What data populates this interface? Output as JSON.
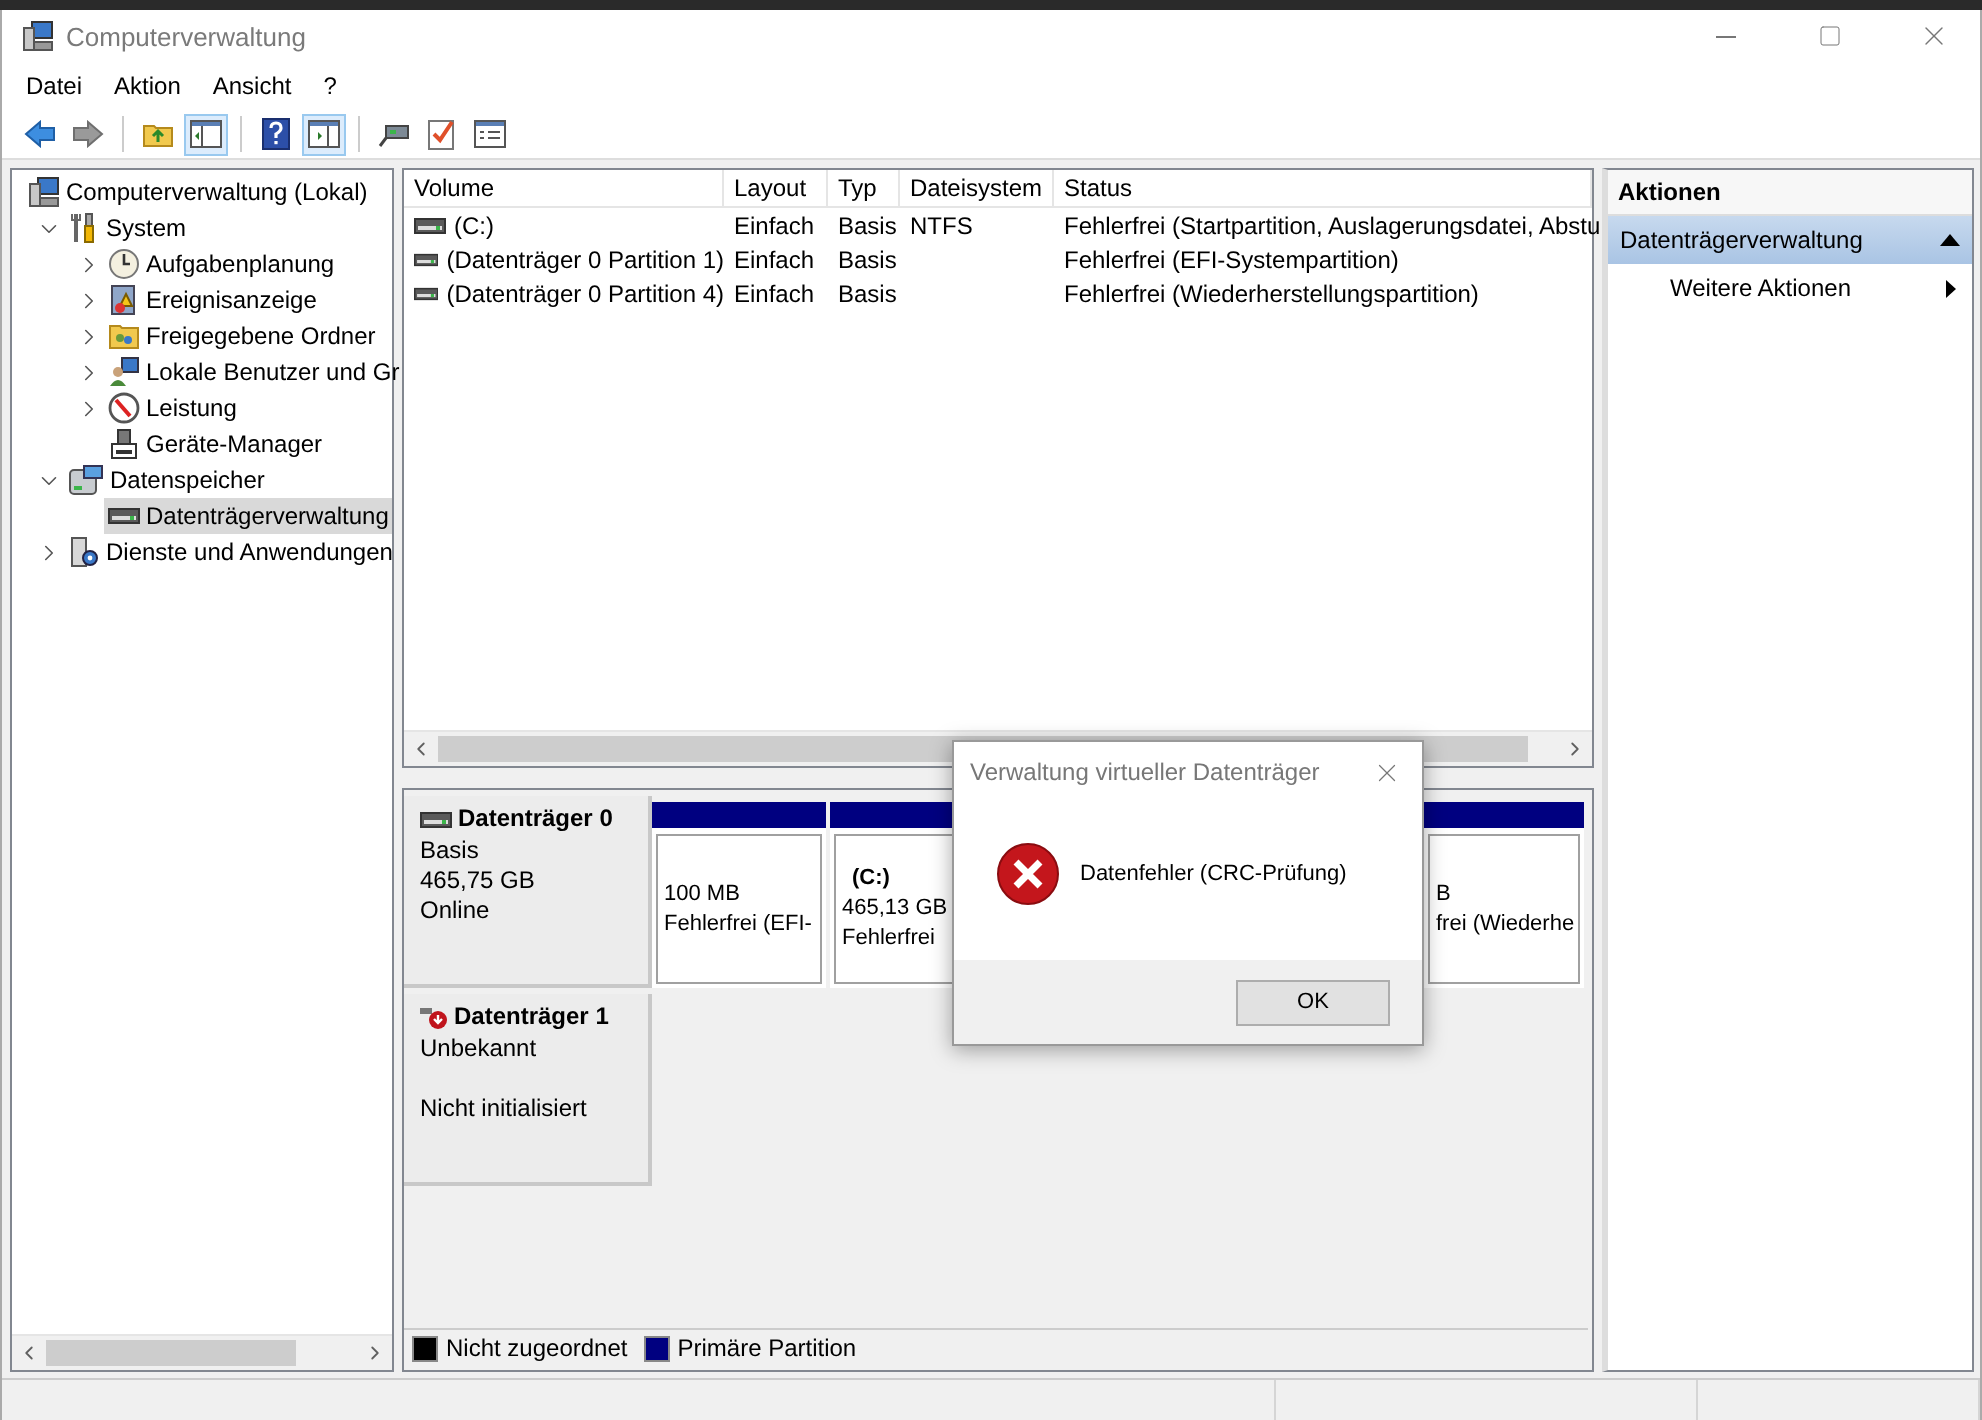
{
  "window": {
    "title": "Computerverwaltung"
  },
  "menu": [
    "Datei",
    "Aktion",
    "Ansicht",
    "?"
  ],
  "toolbar": [
    [
      {
        "kind": "back",
        "pressed": false
      },
      {
        "kind": "forward",
        "pressed": false
      }
    ],
    [
      {
        "kind": "folder-up",
        "pressed": false
      },
      {
        "kind": "tree-pane",
        "pressed": true
      }
    ],
    [
      {
        "kind": "help",
        "pressed": false
      },
      {
        "kind": "action-pane",
        "pressed": true
      }
    ],
    [
      {
        "kind": "connect",
        "pressed": false
      },
      {
        "kind": "check",
        "pressed": false
      },
      {
        "kind": "properties",
        "pressed": false
      }
    ]
  ],
  "tree": [
    {
      "label": "Computerverwaltung (Lokal)",
      "selected": false,
      "children": [
        {
          "label": "System",
          "expanded": true,
          "selected": false,
          "children": [
            {
              "label": "Aufgabenplanung",
              "expanded": false,
              "selected": false
            },
            {
              "label": "Ereignisanzeige",
              "expanded": false,
              "selected": false
            },
            {
              "label": "Freigegebene Ordner",
              "expanded": false,
              "selected": false
            },
            {
              "label": "Lokale Benutzer und Gr",
              "expanded": false,
              "selected": false
            },
            {
              "label": "Leistung",
              "expanded": false,
              "selected": false
            },
            {
              "label": "Geräte-Manager",
              "selected": false
            }
          ]
        },
        {
          "label": "Datenspeicher",
          "expanded": true,
          "selected": false,
          "children": [
            {
              "label": "Datenträgerverwaltung",
              "selected": true
            }
          ]
        },
        {
          "label": "Dienste und Anwendungen",
          "expanded": false,
          "selected": false
        }
      ]
    }
  ],
  "table": {
    "columns": [
      "Volume",
      "Layout",
      "Typ",
      "Dateisystem",
      "Status"
    ],
    "rows": [
      {
        "volume": "(C:)",
        "layout": "Einfach",
        "type": "Basis",
        "filesystem": "NTFS",
        "status": "Fehlerfrei (Startpartition, Auslagerungsdatei, Abstu"
      },
      {
        "volume": "(Datenträger 0 Partition 1)",
        "layout": "Einfach",
        "type": "Basis",
        "status": "Fehlerfrei (EFI-Systempartition)"
      },
      {
        "volume": "(Datenträger 0 Partition 4)",
        "layout": "Einfach",
        "type": "Basis",
        "status": "Fehlerfrei (Wiederherstellungspartition)"
      }
    ]
  },
  "disks": [
    {
      "name": "Datenträger 0",
      "kind": "online",
      "type": "Basis",
      "size": "465,75 GB",
      "status": "Online",
      "partitions": [
        {
          "size": "100 MB",
          "status": "Fehlerfrei (EFI-"
        },
        {
          "label": "(C:)",
          "size": "465,13 GB",
          "status": "Fehlerfrei"
        },
        {
          "size": "B",
          "status": "frei (Wiederhe"
        }
      ]
    },
    {
      "name": "Datenträger 1",
      "kind": "error",
      "type": "Unbekannt",
      "status": "Nicht initialisiert"
    }
  ],
  "legend": [
    {
      "label": "Nicht zugeordnet",
      "color": "#000000"
    },
    {
      "label": "Primäre Partition",
      "color": "#000080"
    }
  ],
  "actions": {
    "title": "Aktionen",
    "section": {
      "label": "Datenträgerverwaltung",
      "expanded": true
    },
    "items": [
      "Weitere Aktionen"
    ]
  },
  "dialog": {
    "title": "Verwaltung virtueller Datenträger",
    "message": "Datenfehler (CRC-Prüfung)",
    "button": "OK"
  }
}
